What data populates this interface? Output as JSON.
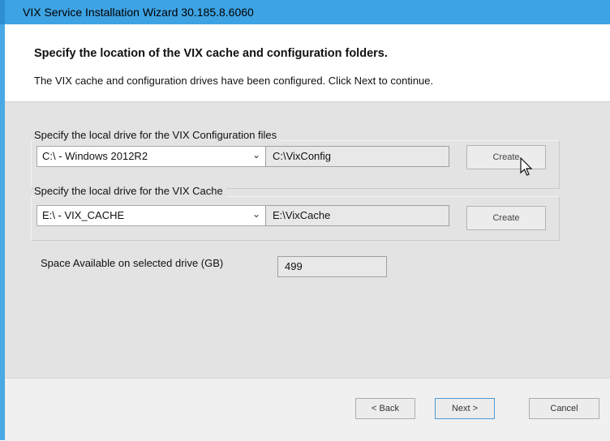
{
  "window": {
    "title": "VIX Service Installation Wizard 30.185.8.6060"
  },
  "header": {
    "title": "Specify the location of the VIX cache and configuration folders.",
    "subtitle": "The VIX cache and configuration drives have been configured. Click Next to continue."
  },
  "config_group": {
    "label": "Specify the local drive for the VIX Configuration files",
    "drive_selected": "C:\\ - Windows 2012R2",
    "path": "C:\\VixConfig",
    "create_label": "Create"
  },
  "cache_group": {
    "label": "Specify the local drive for the VIX Cache",
    "drive_selected": "E:\\ - VIX_CACHE",
    "path": "E:\\VixCache",
    "create_label": "Create"
  },
  "space": {
    "label": "Space Available on selected drive (GB)",
    "value": "499"
  },
  "footer": {
    "back_label": "< Back",
    "next_label": "Next >",
    "cancel_label": "Cancel"
  },
  "icons": {
    "dropdown": "chevron-down-icon",
    "cursor": "mouse-pointer-icon"
  },
  "colors": {
    "titlebar": "#3ea3e3",
    "content_bg": "#e3e3e3"
  }
}
